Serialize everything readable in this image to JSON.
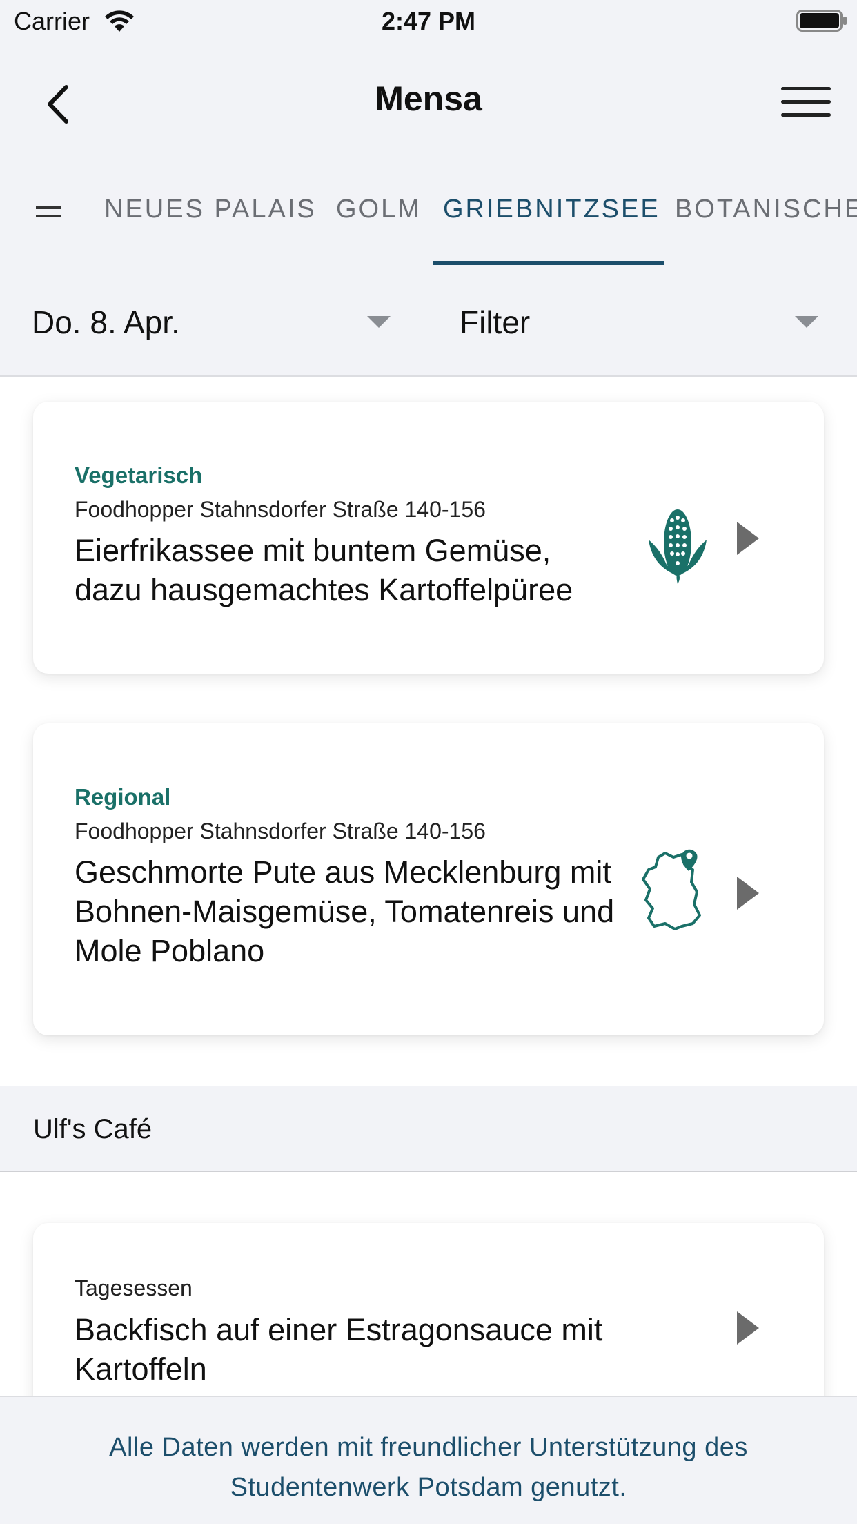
{
  "status_bar": {
    "carrier": "Carrier",
    "time": "2:47 PM"
  },
  "nav": {
    "title": "Mensa",
    "back_icon": "chevron-left-icon",
    "menu_icon": "hamburger-menu-icon"
  },
  "tabs": {
    "items": [
      {
        "label": "NEUES PALAIS"
      },
      {
        "label": "GOLM"
      },
      {
        "label": "GRIEBNITZSEE",
        "active": true
      },
      {
        "label": "BOTANISCHE"
      }
    ]
  },
  "filters": {
    "date": "Do. 8. Apr.",
    "filter": "Filter"
  },
  "meals": [
    {
      "category": "Vegetarisch",
      "location": "Foodhopper Stahnsdorfer Straße 140-156",
      "title": "Eierfrikassee mit buntem Gemüse, dazu hausgemachtes Kartoffelpüree",
      "icon": "corn-icon"
    },
    {
      "category": "Regional",
      "location": "Foodhopper Stahnsdorfer Straße 140-156",
      "title": "Geschmorte Pute aus Mecklenburg mit Bohnen-Maisgemüse, Tomatenreis und Mole Poblano",
      "icon": "germany-map-pin-icon"
    }
  ],
  "section": {
    "title": "Ulf's Café"
  },
  "cafe_meals": [
    {
      "category": "Tagesessen",
      "title": "Backfisch auf einer Estragonsauce mit Kartoffeln"
    }
  ],
  "footer": {
    "text": "Alle Daten werden mit freundlicher Unterstützung des Studentenwerk Potsdam genutzt."
  },
  "colors": {
    "accent": "#1c4e6b",
    "category_green": "#1a7068",
    "background_gray": "#f2f3f7"
  }
}
